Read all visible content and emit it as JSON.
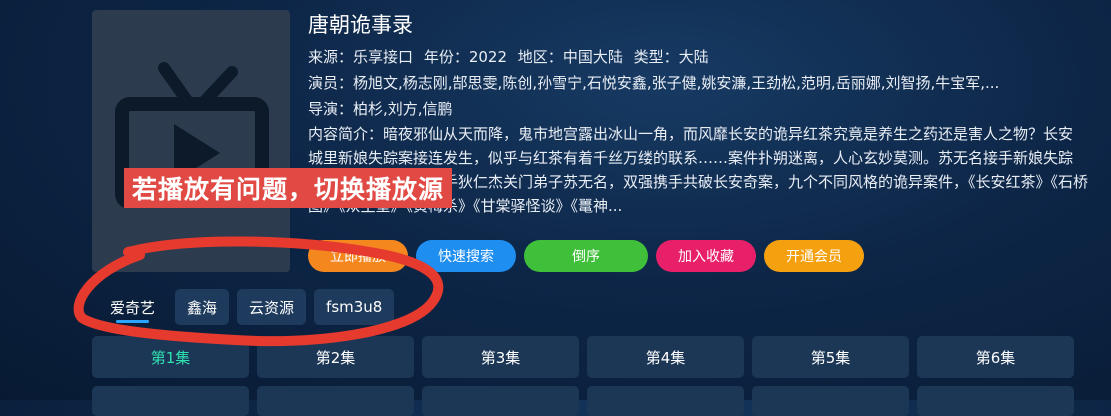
{
  "title": "唐朝诡事录",
  "meta": {
    "source_label": "来源：",
    "source": "乐享接口",
    "year_label": "年份：",
    "year": "2022",
    "region_label": "地区：",
    "region": "中国大陆",
    "type_label": "类型：",
    "type": "大陆"
  },
  "actors_label": "演员：",
  "actors": "杨旭文,杨志刚,郜思雯,陈创,孙雪宁,石悦安鑫,张子健,姚安濂,王劲松,范明,岳丽娜,刘智扬,牛宝军,...",
  "director_label": "导演：",
  "directors": "柏杉,刘方,信鹏",
  "summary_label": "内容简介：",
  "summary": "暗夜邪仙从天而降，鬼市地宫露出冰山一角，而风靡长安的诡异红茶究竟是养生之药还是害人之物？长安城里新娘失踪案接连发生，似乎与红茶有着千丝万缕的联系……案件扑朔迷离，人心玄妙莫测。苏无名接手新娘失踪案，遭遇平生最强对手狄仁杰关门弟子苏无名，双强携手共破长安奇案，九个不同风格的诡异案件，《长安红茶》《石桥图》《众生堂》《黄梅杀》《甘棠驿怪谈》《鼍神...",
  "banner": "若播放有问题，切换播放源",
  "buttons": [
    {
      "label": "立即播放",
      "color": "#f5871f"
    },
    {
      "label": "快速搜索",
      "color": "#1e8ef0"
    },
    {
      "label": "倒序",
      "color": "#3fbf3a"
    },
    {
      "label": "加入收藏",
      "color": "#e8206a"
    },
    {
      "label": "开通会员",
      "color": "#f5a00f"
    }
  ],
  "sources": [
    "爱奇艺",
    "鑫海",
    "云资源",
    "fsm3u8"
  ],
  "episodes": [
    "第1集",
    "第2集",
    "第3集",
    "第4集",
    "第5集",
    "第6集"
  ],
  "colors": {
    "accent": "#2aa5ff",
    "active_episode": "#2fe0b0",
    "annotation": "#e63a2e"
  }
}
